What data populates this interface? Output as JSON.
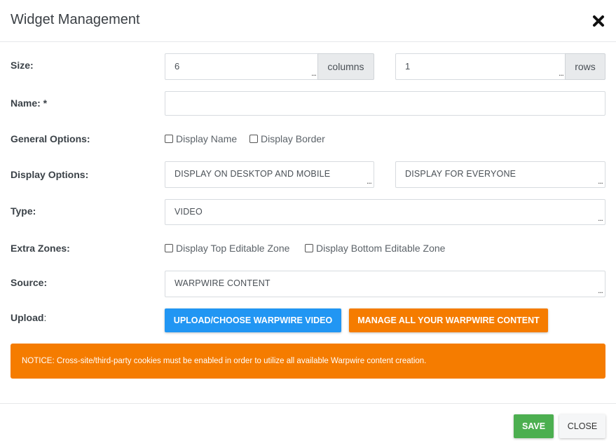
{
  "modal": {
    "title": "Widget Management",
    "close_icon": "close-x-icon"
  },
  "size": {
    "label": "Size:",
    "columns_value": "6",
    "columns_addon": "columns",
    "rows_value": "1",
    "rows_addon": "rows"
  },
  "name": {
    "label": "Name: *",
    "value": ""
  },
  "general_options": {
    "label": "General Options:",
    "display_name": "Display Name",
    "display_border": "Display Border"
  },
  "display_options": {
    "label": "Display Options:",
    "device_value": "DISPLAY ON DESKTOP AND MOBILE",
    "audience_value": "DISPLAY FOR EVERYONE"
  },
  "type": {
    "label": "Type:",
    "value": "VIDEO"
  },
  "extra_zones": {
    "label": "Extra Zones:",
    "top_zone": "Display Top Editable Zone",
    "bottom_zone": "Display Bottom Editable Zone"
  },
  "source": {
    "label": "Source:",
    "value": "WARPWIRE CONTENT"
  },
  "upload": {
    "label_main": "Upload",
    "label_colon": ":",
    "choose_button": "UPLOAD/CHOOSE WARPWIRE VIDEO",
    "manage_button": "MANAGE ALL YOUR WARPWIRE CONTENT"
  },
  "notice": {
    "text": "NOTICE: Cross-site/third-party cookies must be enabled in order to utilize all available Warpwire content creation."
  },
  "footer": {
    "save": "SAVE",
    "close": "CLOSE"
  },
  "colors": {
    "blue_button": "#2196f3",
    "orange": "#f57c00",
    "green_save": "#4caf50"
  }
}
